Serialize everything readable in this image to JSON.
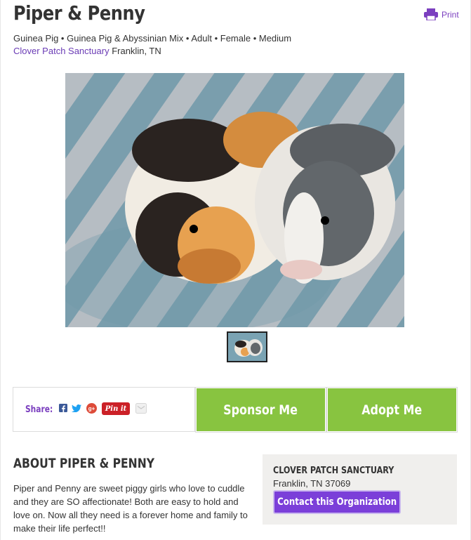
{
  "pet": {
    "name": "Piper & Penny",
    "details": "Guinea Pig • Guinea Pig & Abyssinian Mix • Adult • Female • Medium",
    "organization": "Clover Patch Sanctuary",
    "location": "Franklin, TN"
  },
  "print_label": "Print",
  "share": {
    "label": "Share:",
    "icons": [
      "facebook-icon",
      "twitter-icon",
      "google-plus-icon",
      "pinterest-icon",
      "email-icon"
    ],
    "pinterest_label": "Pin it"
  },
  "actions": {
    "sponsor_label": "Sponsor Me",
    "adopt_label": "Adopt Me"
  },
  "about": {
    "title": "ABOUT PIPER & PENNY",
    "text": "Piper and Penny are sweet piggy girls who love to cuddle and they are SO affectionate! Both are easy to hold and love on. Now all they need is a forever home and family to make their life perfect!!"
  },
  "org_card": {
    "name": "CLOVER PATCH SANCTUARY",
    "location": "Franklin, TN 37069",
    "contact_label": "Contact this Organization"
  },
  "colors": {
    "accent_purple": "#7b3fbf",
    "button_green": "#88c440",
    "org_box_bg": "#f0efed"
  }
}
